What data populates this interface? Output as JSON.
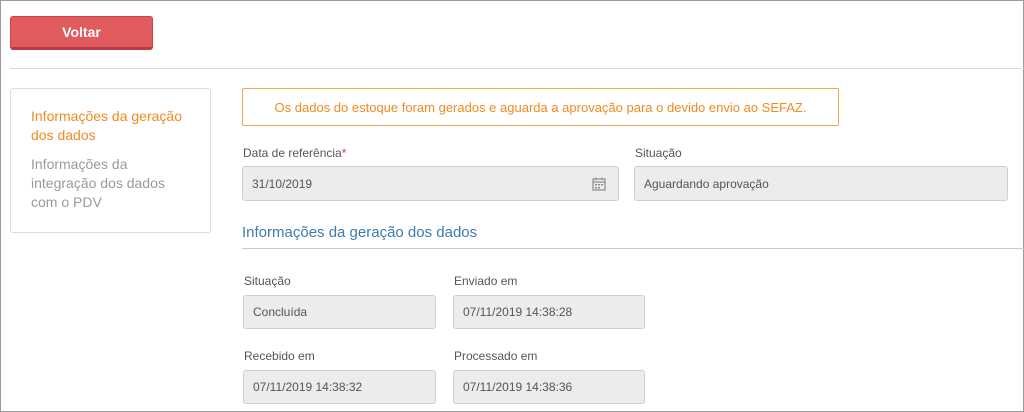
{
  "header": {
    "back_label": "Voltar"
  },
  "sidebar": {
    "items": [
      {
        "label": "Informações da geração dos dados",
        "active": true
      },
      {
        "label": "Informações da integração dos dados com o PDV",
        "active": false
      }
    ]
  },
  "alert": {
    "message": "Os dados do estoque foram gerados e aguarda a aprovação para o devido envio ao SEFAZ."
  },
  "form": {
    "reference_date": {
      "label": "Data de referência",
      "required_mark": "*",
      "value": "31/10/2019",
      "icon": "calendar-icon"
    },
    "situation": {
      "label": "Situação",
      "value": "Aguardando aprovação"
    }
  },
  "generation_section": {
    "title": "Informações da geração dos dados",
    "situation": {
      "label": "Situação",
      "value": "Concluída"
    },
    "sent_at": {
      "label": "Enviado em",
      "value": "07/11/2019 14:38:28"
    },
    "received_at": {
      "label": "Recebido em",
      "value": "07/11/2019 14:38:32"
    },
    "processed_at": {
      "label": "Processado em",
      "value": "07/11/2019 14:38:36"
    }
  },
  "colors": {
    "primary_button": "#e05a5e",
    "accent_orange": "#f08b22",
    "section_blue": "#3d7bb0"
  }
}
